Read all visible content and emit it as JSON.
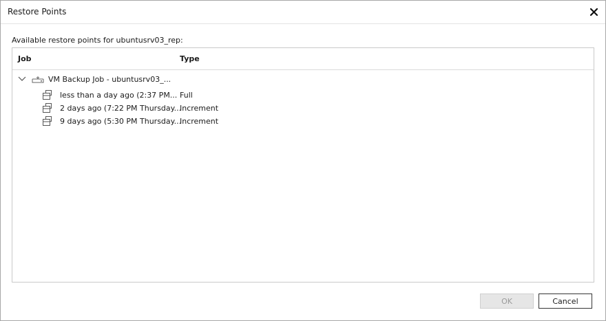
{
  "window": {
    "title": "Restore Points",
    "close_icon": "close-icon"
  },
  "caption": "Available restore points for ubuntusrv03_rep:",
  "table": {
    "columns": [
      "Job",
      "Type"
    ],
    "job_row": {
      "label": "VM Backup Job - ubuntusrv03_...",
      "expanded": true,
      "icon": "backup-job-icon"
    },
    "restore_points": [
      {
        "label": "less than a day ago (2:37 PM...",
        "type": "Full",
        "icon": "restore-point-icon"
      },
      {
        "label": "2 days ago (7:22 PM Thursday...",
        "type": "Increment",
        "icon": "restore-point-icon"
      },
      {
        "label": "9 days ago (5:30 PM Thursday...",
        "type": "Increment",
        "icon": "restore-point-icon"
      }
    ]
  },
  "buttons": {
    "ok_label": "OK",
    "ok_enabled": false,
    "cancel_label": "Cancel"
  }
}
